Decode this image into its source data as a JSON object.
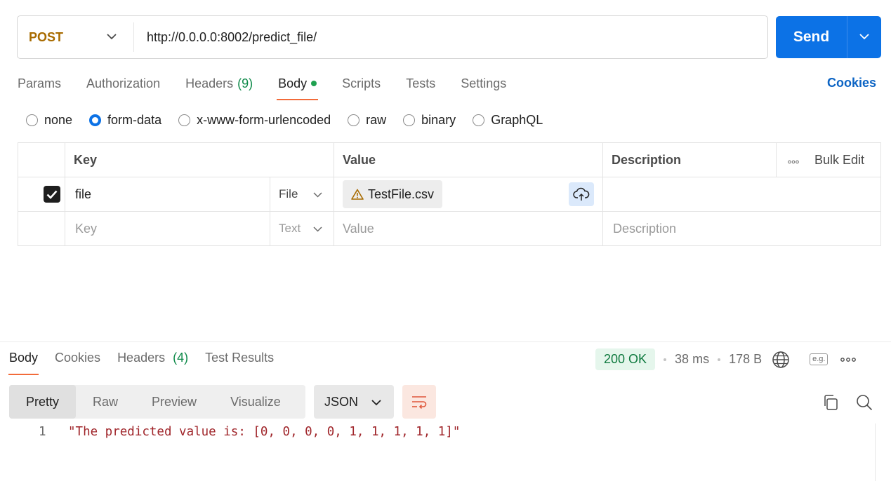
{
  "request": {
    "method": "POST",
    "url": "http://0.0.0.0:8002/predict_file/",
    "send_label": "Send"
  },
  "request_tabs": [
    {
      "label": "Params"
    },
    {
      "label": "Authorization"
    },
    {
      "label": "Headers",
      "count": "(9)"
    },
    {
      "label": "Body",
      "active": true
    },
    {
      "label": "Scripts"
    },
    {
      "label": "Tests"
    },
    {
      "label": "Settings"
    }
  ],
  "cookies_label": "Cookies",
  "body_types": [
    {
      "label": "none"
    },
    {
      "label": "form-data",
      "selected": true
    },
    {
      "label": "x-www-form-urlencoded"
    },
    {
      "label": "raw"
    },
    {
      "label": "binary"
    },
    {
      "label": "GraphQL"
    }
  ],
  "table": {
    "headers": {
      "key": "Key",
      "value": "Value",
      "description": "Description",
      "bulk_edit": "Bulk Edit"
    },
    "rows": [
      {
        "checked": true,
        "key": "file",
        "type": "File",
        "value": "TestFile.csv",
        "description": ""
      }
    ],
    "empty_row": {
      "key": "Key",
      "type": "Text",
      "value": "Value",
      "description": "Description"
    }
  },
  "response_tabs": [
    {
      "label": "Body",
      "active": true
    },
    {
      "label": "Cookies"
    },
    {
      "label": "Headers",
      "count": "(4)"
    },
    {
      "label": "Test Results"
    }
  ],
  "response_meta": {
    "status": "200 OK",
    "time": "38 ms",
    "size": "178 B",
    "example_label": "e.g."
  },
  "view_modes": [
    {
      "label": "Pretty",
      "active": true
    },
    {
      "label": "Raw"
    },
    {
      "label": "Preview"
    },
    {
      "label": "Visualize"
    }
  ],
  "format": "JSON",
  "response_body": {
    "line_number": "1",
    "content": "\"The predicted value is: [0, 0, 0, 0, 1, 1, 1, 1, 1]\""
  },
  "colors": {
    "accent": "#0c72e6",
    "method": "#a86b00",
    "active_tab_underline": "#f26b3a",
    "status_ok": "#0f7a3f"
  }
}
